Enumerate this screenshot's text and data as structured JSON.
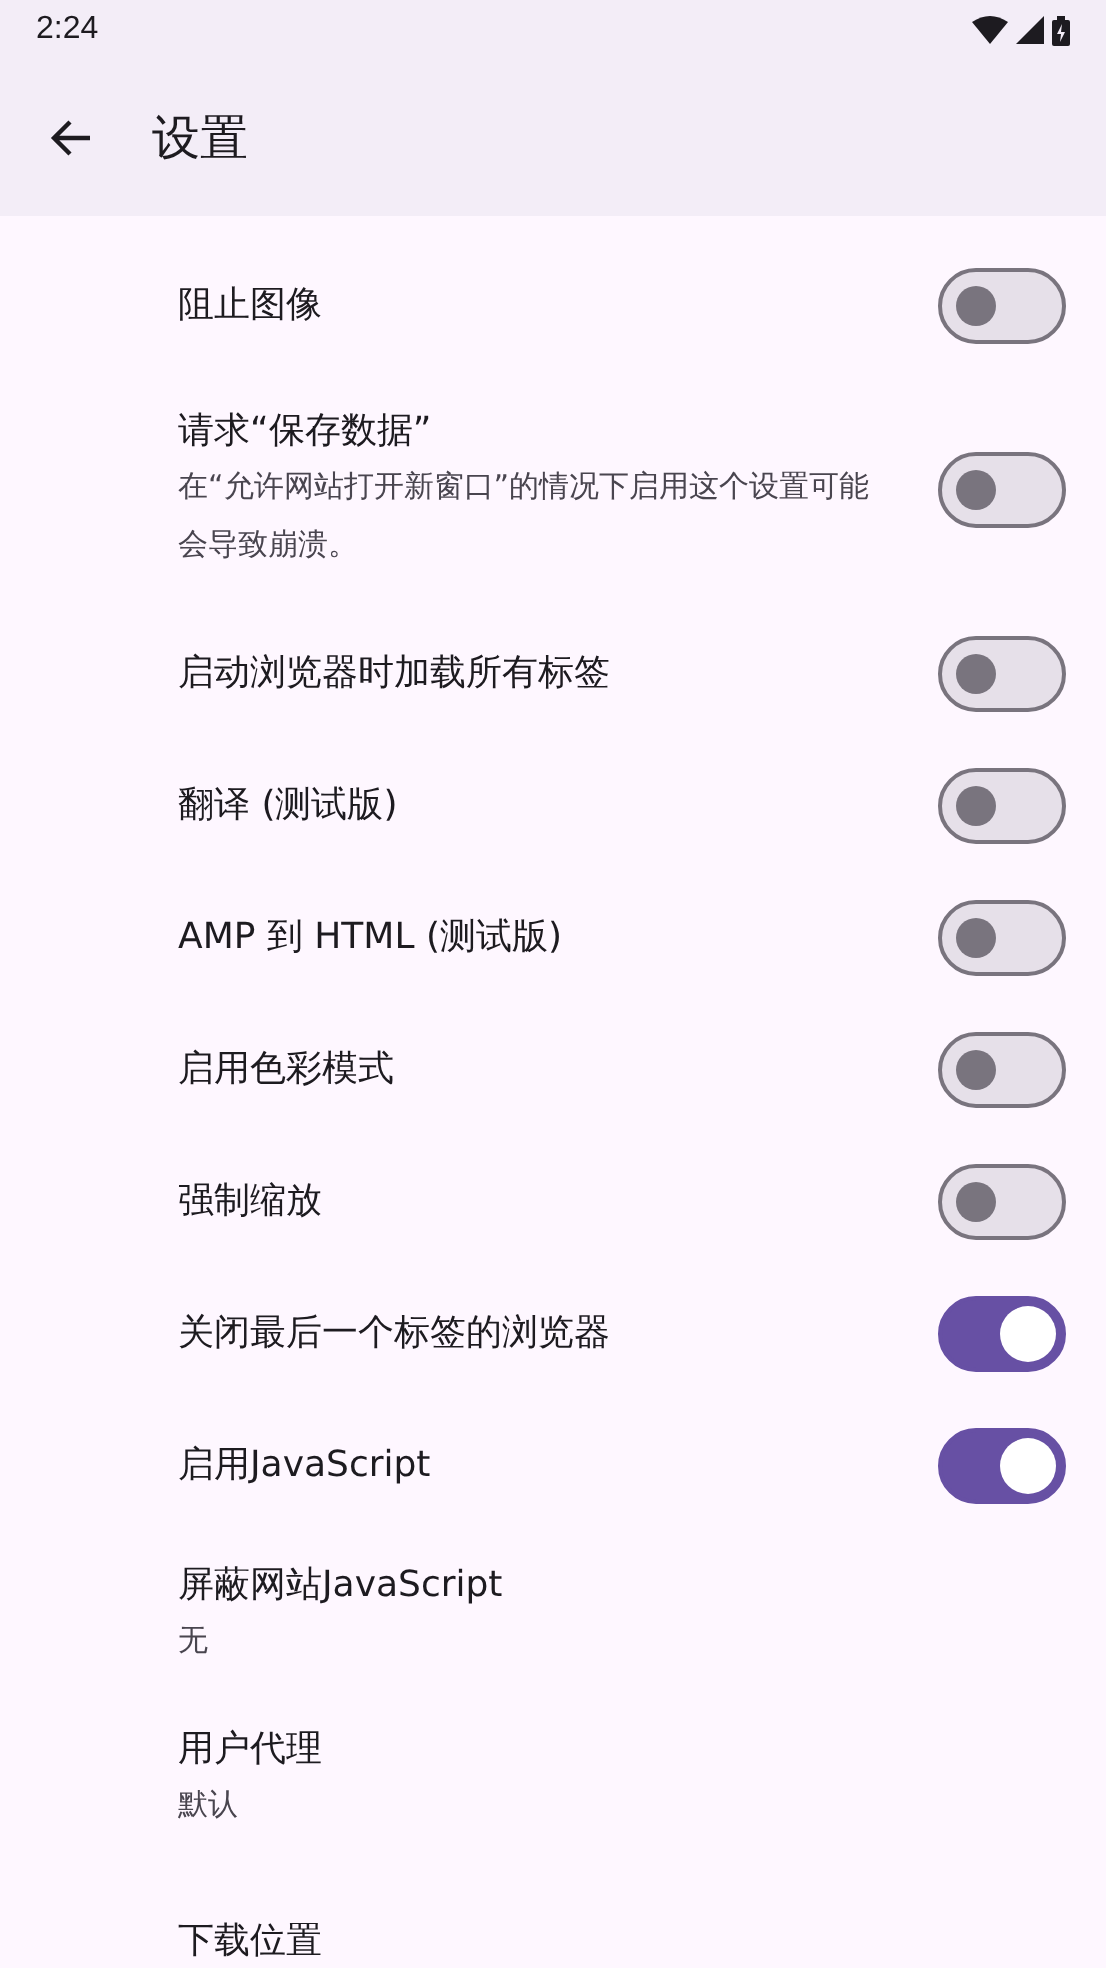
{
  "status_bar": {
    "time": "2:24"
  },
  "app_bar": {
    "title": "设置"
  },
  "settings": [
    {
      "kind": "switch",
      "title": "阻止图像",
      "on": false
    },
    {
      "kind": "switch",
      "title": "请求“保存数据”",
      "summary": "在“允许网站打开新窗口”的情况下启用这个设置可能会导致崩溃。",
      "on": false
    },
    {
      "kind": "switch",
      "title": "启动浏览器时加载所有标签",
      "on": false
    },
    {
      "kind": "switch",
      "title": "翻译 (测试版)",
      "on": false
    },
    {
      "kind": "switch",
      "title": "AMP 到 HTML (测试版)",
      "on": false
    },
    {
      "kind": "switch",
      "title": "启用色彩模式",
      "on": false
    },
    {
      "kind": "switch",
      "title": "强制缩放",
      "on": false
    },
    {
      "kind": "switch",
      "title": "关闭最后一个标签的浏览器",
      "on": true
    },
    {
      "kind": "switch",
      "title": "启用JavaScript",
      "on": true
    },
    {
      "kind": "choice",
      "title": "屏蔽网站JavaScript",
      "summary": "无"
    },
    {
      "kind": "choice",
      "title": "用户代理",
      "summary": "默认"
    },
    {
      "kind": "choice",
      "title": "下载位置"
    }
  ]
}
